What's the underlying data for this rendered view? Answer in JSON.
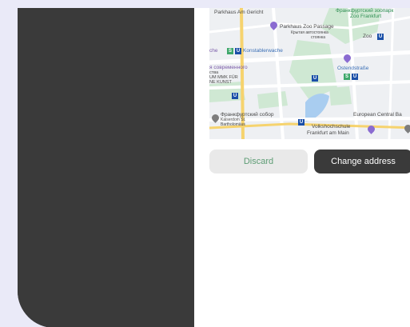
{
  "map": {
    "labels": {
      "parkhaus_am_gericht": "Parkhaus Am Gericht",
      "zoo_top": "Франкфуртский зоопарк",
      "zoo_frankfurt": "Zoo Frankfurt",
      "parkhaus_zoo_passage": "Parkhaus Zoo Passage",
      "parking_note": "Крытая автостоянка",
      "parking_note2": "стоянка",
      "zoo": "Zoo",
      "konstablerwache": "Konstablerwache",
      "museum_ru": "я современного",
      "museum_ru2": "ства",
      "museum_mmk": "UM MMK FÜR",
      "museum_kunst": "NE KUNST",
      "ostendstrasse": "Ostendstraße",
      "cathedral_ru": "Франкфуртский собор",
      "cathedral_de": "Kaiserdom St.",
      "cathedral_de2": "Bartholomäus",
      "volkshochschule": "Volkshochschule",
      "frankfurt_am_main": "Frankfurt am Main",
      "ecb": "European Central Ba"
    },
    "colors": {
      "water": "#a9cdf0",
      "park": "#cfe8d3",
      "road": "#ffffff",
      "main_road": "#f6d36e"
    },
    "map_button_icon": "map-control-icon"
  },
  "actions": {
    "discard_label": "Discard",
    "change_address_label": "Change address"
  },
  "colors": {
    "background": "#eaeaf8",
    "dark_panel": "#3a3a3a",
    "discard_text": "#5d9c74",
    "discard_bg": "#e9e9e9",
    "primary_bg": "#3a3a3a"
  }
}
